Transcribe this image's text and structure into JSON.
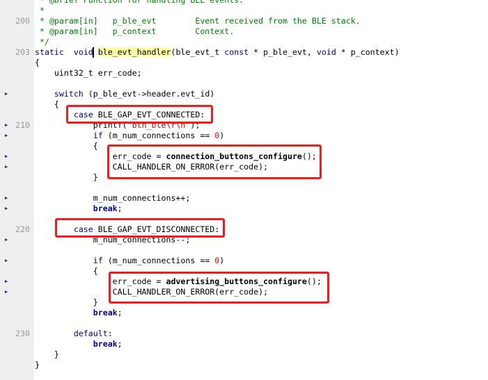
{
  "editor": {
    "colors": {
      "keyword": "#00008b",
      "comment": "#008000",
      "number": "#e00000",
      "highlight": "#ffffa8",
      "annotation": "#ee1c1c"
    },
    "marker_icon": "collapse-arrow-icon",
    "lines": [
      {
        "n": 198,
        "num": "",
        "marker": false,
        "tokens": [
          [
            "cm",
            " * @brief Function for handling BLE events."
          ]
        ]
      },
      {
        "n": 199,
        "num": "",
        "marker": false,
        "tokens": [
          [
            "cm",
            " *"
          ]
        ]
      },
      {
        "n": 200,
        "num": "200",
        "marker": false,
        "tokens": [
          [
            "cm",
            " * @param[in]   p_ble_evt        Event received from the BLE stack."
          ]
        ]
      },
      {
        "n": 201,
        "num": "",
        "marker": false,
        "tokens": [
          [
            "cm",
            " * @param[in]   p_context        Context."
          ]
        ]
      },
      {
        "n": 202,
        "num": "",
        "marker": false,
        "tokens": [
          [
            "cm",
            " */"
          ]
        ]
      },
      {
        "n": 203,
        "num": "203",
        "marker": false,
        "tokens": [
          [
            "kw",
            "static"
          ],
          [
            "",
            "  "
          ],
          [
            "kw",
            "void"
          ],
          [
            "",
            " "
          ],
          [
            "hl",
            "ble_evt_handler"
          ],
          [
            "",
            "(ble_evt_t "
          ],
          [
            "kw",
            "const"
          ],
          [
            "",
            " * p_ble_evt, "
          ],
          [
            "kw",
            "void"
          ],
          [
            "",
            " * p_context)"
          ]
        ]
      },
      {
        "n": 204,
        "num": "",
        "marker": false,
        "tokens": [
          [
            "",
            "{"
          ]
        ]
      },
      {
        "n": 205,
        "num": "",
        "marker": false,
        "tokens": [
          [
            "",
            "    uint32_t err_code;"
          ]
        ]
      },
      {
        "n": 206,
        "num": "",
        "marker": false,
        "tokens": []
      },
      {
        "n": 207,
        "num": "",
        "marker": true,
        "tokens": [
          [
            "",
            "    "
          ],
          [
            "kw",
            "switch"
          ],
          [
            "",
            " (p_ble_evt->header.evt_id)"
          ]
        ]
      },
      {
        "n": 208,
        "num": "",
        "marker": false,
        "tokens": [
          [
            "",
            "    {"
          ]
        ]
      },
      {
        "n": 209,
        "num": "",
        "marker": false,
        "tokens": [
          [
            "",
            "        "
          ],
          [
            "kw",
            "case"
          ],
          [
            "",
            " BLE_GAP_EVT_CONNECTED:"
          ]
        ]
      },
      {
        "n": 210,
        "num": "210",
        "marker": true,
        "tokens": [
          [
            "",
            "            printf("
          ],
          [
            "str",
            "\"bth_ble\\r\\n\""
          ],
          [
            "",
            ");"
          ]
        ]
      },
      {
        "n": 211,
        "num": "",
        "marker": true,
        "tokens": [
          [
            "",
            "            "
          ],
          [
            "kw",
            "if"
          ],
          [
            "",
            " (m_num_connections == "
          ],
          [
            "num",
            "0"
          ],
          [
            "",
            ")"
          ]
        ]
      },
      {
        "n": 212,
        "num": "",
        "marker": false,
        "tokens": [
          [
            "",
            "            {"
          ]
        ]
      },
      {
        "n": 213,
        "num": "",
        "marker": true,
        "tokens": [
          [
            "",
            "                err_code = "
          ],
          [
            "fn",
            "connection_buttons_configure"
          ],
          [
            "",
            "();"
          ]
        ]
      },
      {
        "n": 214,
        "num": "",
        "marker": true,
        "tokens": [
          [
            "",
            "                CALL_HANDLER_ON_ERROR(err_code);"
          ]
        ]
      },
      {
        "n": 215,
        "num": "",
        "marker": false,
        "tokens": [
          [
            "",
            "            }"
          ]
        ]
      },
      {
        "n": 216,
        "num": "",
        "marker": false,
        "tokens": []
      },
      {
        "n": 217,
        "num": "",
        "marker": true,
        "tokens": [
          [
            "",
            "            m_num_connections++;"
          ]
        ]
      },
      {
        "n": 218,
        "num": "",
        "marker": true,
        "tokens": [
          [
            "",
            "            "
          ],
          [
            "kwb",
            "break"
          ],
          [
            "",
            ";"
          ]
        ]
      },
      {
        "n": 219,
        "num": "",
        "marker": false,
        "tokens": []
      },
      {
        "n": 220,
        "num": "220",
        "marker": false,
        "tokens": [
          [
            "",
            "        "
          ],
          [
            "kw",
            "case"
          ],
          [
            "",
            " BLE_GAP_EVT_DISCONNECTED:"
          ]
        ]
      },
      {
        "n": 221,
        "num": "",
        "marker": true,
        "tokens": [
          [
            "",
            "            m_num_connections--;"
          ]
        ]
      },
      {
        "n": 222,
        "num": "",
        "marker": false,
        "tokens": []
      },
      {
        "n": 223,
        "num": "",
        "marker": true,
        "tokens": [
          [
            "",
            "            "
          ],
          [
            "kw",
            "if"
          ],
          [
            "",
            " (m_num_connections == "
          ],
          [
            "num",
            "0"
          ],
          [
            "",
            ")"
          ]
        ]
      },
      {
        "n": 224,
        "num": "",
        "marker": false,
        "tokens": [
          [
            "",
            "            {"
          ]
        ]
      },
      {
        "n": 225,
        "num": "",
        "marker": true,
        "tokens": [
          [
            "",
            "                err_code = "
          ],
          [
            "fn",
            "advertising_buttons_configure"
          ],
          [
            "",
            "();"
          ]
        ]
      },
      {
        "n": 226,
        "num": "",
        "marker": true,
        "tokens": [
          [
            "",
            "                CALL_HANDLER_ON_ERROR(err_code);"
          ]
        ]
      },
      {
        "n": 227,
        "num": "",
        "marker": false,
        "tokens": [
          [
            "",
            "            }"
          ]
        ]
      },
      {
        "n": 228,
        "num": "",
        "marker": false,
        "tokens": [
          [
            "",
            "            "
          ],
          [
            "kwb",
            "break"
          ],
          [
            "",
            ";"
          ]
        ]
      },
      {
        "n": 229,
        "num": "",
        "marker": false,
        "tokens": []
      },
      {
        "n": 230,
        "num": "230",
        "marker": false,
        "tokens": [
          [
            "",
            "        "
          ],
          [
            "kw",
            "default"
          ],
          [
            "",
            ":"
          ]
        ]
      },
      {
        "n": 231,
        "num": "",
        "marker": false,
        "tokens": [
          [
            "",
            "            "
          ],
          [
            "kwb",
            "break"
          ],
          [
            "",
            ";"
          ]
        ]
      },
      {
        "n": 232,
        "num": "",
        "marker": false,
        "tokens": [
          [
            "",
            "    }"
          ]
        ]
      },
      {
        "n": 233,
        "num": "",
        "marker": false,
        "tokens": [
          [
            "",
            "}"
          ]
        ]
      }
    ]
  }
}
